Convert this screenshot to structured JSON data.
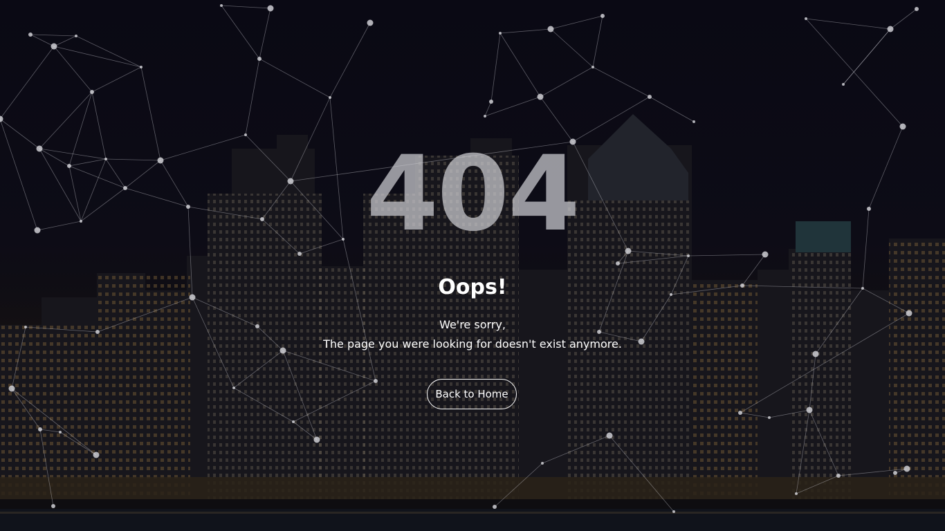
{
  "error": {
    "code": "404",
    "headline": "Oops!",
    "message_line1": "We're sorry,",
    "message_line2": "The page you were looking for doesn't exist anymore."
  },
  "actions": {
    "home_label": "Back to Home"
  },
  "background": {
    "description_icon": "city-skyline-night",
    "overlay_icon": "particle-network"
  },
  "colors": {
    "page_background": "#0b0a12",
    "text": "#ffffff",
    "code_text": "#cdcdd2",
    "network_lines": "#cfcfd6"
  }
}
